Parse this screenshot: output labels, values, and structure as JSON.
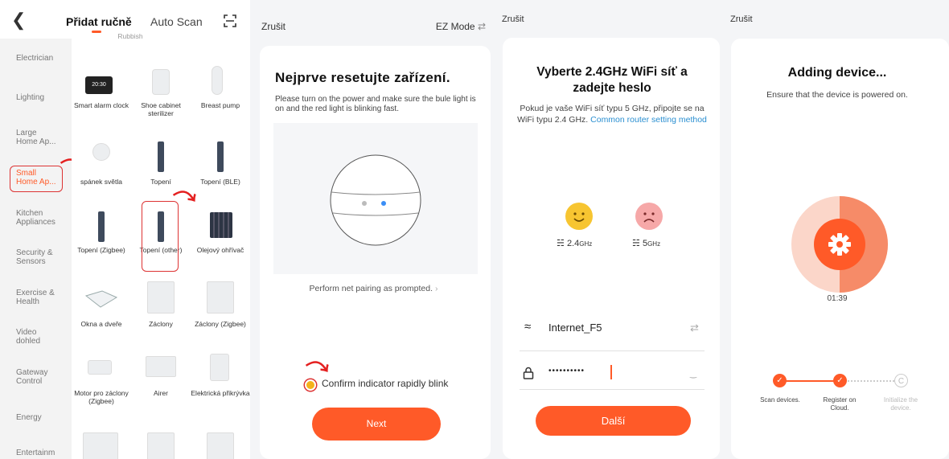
{
  "colors": {
    "accent": "#ff5a28",
    "annotation": "#e42020",
    "link": "#2a8fd1"
  },
  "panel1": {
    "tab_manual": "Přidat ručně",
    "tab_auto": "Auto Scan",
    "partial_top_label": "Rubbish",
    "categories": [
      "Electrician",
      "Lighting",
      "Large Home Ap...",
      "Small Home Ap...",
      "Kitchen Appliances",
      "Security & Sensors",
      "Exercise & Health",
      "Video dohled",
      "Gateway Control",
      "Energy",
      "Entertainm"
    ],
    "devices": {
      "clock_screen": "20:30",
      "d1": "Smart alarm clock",
      "d2": "Shoe cabinet sterilizer",
      "d3": "Breast pump",
      "d4": "spánek světla",
      "d5": "Topení",
      "d6": "Topení (BLE)",
      "d7": "Topení (Zigbee)",
      "d8": "Topení (other)",
      "d9": "Olejový ohřívač",
      "d10": "Okna a dveře",
      "d11": "Záclony",
      "d12": "Záclony (Zigbee)",
      "d13": "Motor pro záclony (Zigbee)",
      "d14": "Airer",
      "d15": "Elektrická přikrývka"
    }
  },
  "panel2": {
    "cancel": "Zrušit",
    "mode": "EZ Mode",
    "title": "Nejprve resetujte zařízení.",
    "desc": "Please turn on the power and make sure the bule light is on and the red light is blinking fast.",
    "perform": "Perform net pairing as prompted.",
    "confirm": "Confirm indicator rapidly blink",
    "next": "Next"
  },
  "panel3": {
    "cancel": "Zrušit",
    "title": "Vyberte 2.4GHz WiFi síť a zadejte heslo",
    "desc": "Pokud je vaše WiFi síť typu 5 GHz, připojte se na WiFi typu 2.4 GHz.",
    "link": "Common router setting method",
    "band_good_num": "2.4",
    "band_good_unit": "GHz",
    "band_bad_num": "5",
    "band_bad_unit": "GHz",
    "ssid": "Internet_F5",
    "password": "••••••••••",
    "next": "Další"
  },
  "panel4": {
    "cancel": "Zrušit",
    "title": "Adding device...",
    "desc": "Ensure that the device is powered on.",
    "progress": 0.5,
    "timer": "01:39",
    "steps": [
      "Scan devices.",
      "Register on Cloud.",
      "Initialize the device."
    ],
    "step3_icon": "C"
  }
}
